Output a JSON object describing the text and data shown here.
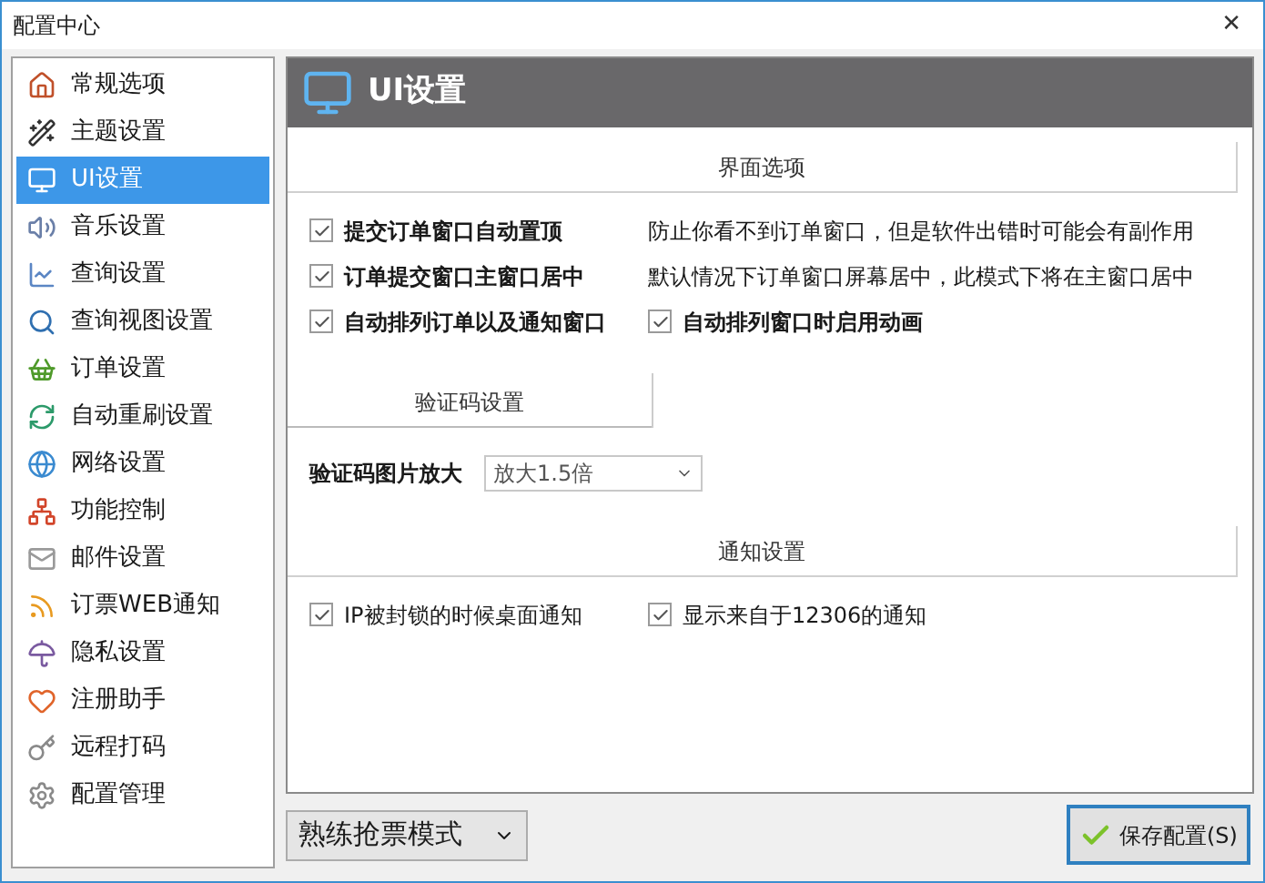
{
  "window": {
    "title": "配置中心",
    "close": "✕"
  },
  "sidebar": {
    "items": [
      {
        "label": "常规选项",
        "selected": false
      },
      {
        "label": "主题设置",
        "selected": false
      },
      {
        "label": "UI设置",
        "selected": true
      },
      {
        "label": "音乐设置",
        "selected": false
      },
      {
        "label": "查询设置",
        "selected": false
      },
      {
        "label": "查询视图设置",
        "selected": false
      },
      {
        "label": "订单设置",
        "selected": false
      },
      {
        "label": "自动重刷设置",
        "selected": false
      },
      {
        "label": "网络设置",
        "selected": false
      },
      {
        "label": "功能控制",
        "selected": false
      },
      {
        "label": "邮件设置",
        "selected": false
      },
      {
        "label": "订票WEB通知",
        "selected": false
      },
      {
        "label": "隐私设置",
        "selected": false
      },
      {
        "label": "注册助手",
        "selected": false
      },
      {
        "label": "远程打码",
        "selected": false
      },
      {
        "label": "配置管理",
        "selected": false
      }
    ]
  },
  "panel": {
    "title": "UI设置",
    "sections": [
      {
        "kind": "banner",
        "title": "界面选项",
        "rows": [
          [
            {
              "kind": "checkbox",
              "label": "提交订单窗口自动置顶",
              "checked": true,
              "bold": true
            },
            {
              "kind": "note",
              "text": "防止你看不到订单窗口，但是软件出错时可能会有副作用"
            }
          ],
          [
            {
              "kind": "checkbox",
              "label": "订单提交窗口主窗口居中",
              "checked": true,
              "bold": true
            },
            {
              "kind": "note",
              "text": "默认情况下订单窗口屏幕居中，此模式下将在主窗口居中"
            }
          ],
          [
            {
              "kind": "checkbox",
              "label": "自动排列订单以及通知窗口",
              "checked": true,
              "bold": true
            },
            {
              "kind": "checkbox",
              "label": "自动排列窗口时启用动画",
              "checked": true,
              "bold": true
            }
          ]
        ]
      },
      {
        "kind": "tab",
        "title": "验证码设置",
        "rows": [
          [
            {
              "kind": "select",
              "label": "验证码图片放大",
              "value": "放大1.5倍"
            }
          ]
        ]
      },
      {
        "kind": "banner",
        "title": "通知设置",
        "rows": [
          [
            {
              "kind": "checkbox",
              "label": "IP被封锁的时候桌面通知",
              "checked": true,
              "bold": false
            },
            {
              "kind": "checkbox",
              "label": "显示来自于12306的通知",
              "checked": true,
              "bold": false
            }
          ]
        ]
      }
    ]
  },
  "footer": {
    "mode_select": "熟练抢票模式",
    "save_button": "保存配置(S)"
  }
}
